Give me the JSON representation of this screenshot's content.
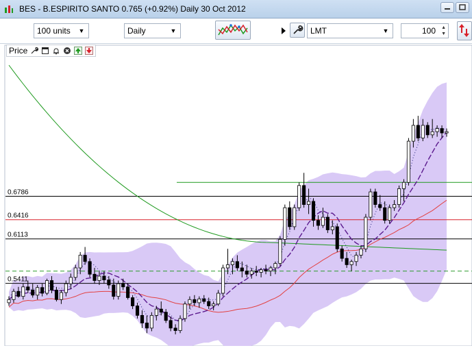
{
  "window": {
    "title": "BES - B.ESPIRITO SANTO   0.765 (+0.92%)   Daily  30 Oct 2012",
    "buttons": [
      "minimize",
      "maximize"
    ]
  },
  "toolbar": {
    "units_value": "100 units",
    "period_value": "Daily",
    "order_type_value": "LMT",
    "quantity_value": "100",
    "icons": [
      "indicator-chart-icon",
      "collapse-arrow-icon",
      "wrench-icon",
      "order-arrows-icon"
    ]
  },
  "legend": {
    "label": "Price",
    "icons": [
      "wrench-icon",
      "window-icon",
      "alarm-icon",
      "close-icon",
      "move-up-icon",
      "move-down-icon"
    ]
  },
  "colors": {
    "band_fill": "#d9c9f6",
    "up_candle": "#ffffff",
    "down_candle": "#000000",
    "ma_green": "#1f9a1f",
    "ma_red": "#e34040",
    "ma_purple": "#5b1a8e",
    "level_line": "#000000",
    "level_red": "#d8202a",
    "level_green": "#1f9a1f",
    "level_green_dashed": "#2a9a2a"
  },
  "chart_data": {
    "type": "candlestick",
    "title": "",
    "ylim": [
      0.445,
      0.91
    ],
    "levels": [
      {
        "value": 0.7005,
        "label": "",
        "style": "solid-green"
      },
      {
        "value": 0.6786,
        "label": "0.6786",
        "style": "solid-black"
      },
      {
        "value": 0.6416,
        "label": "0.6416",
        "style": "solid-red"
      },
      {
        "value": 0.6113,
        "label": "0.6113",
        "style": "solid-black"
      },
      {
        "value": 0.5605,
        "label": "",
        "style": "dashed-green"
      },
      {
        "value": 0.5411,
        "label": "0.5411",
        "style": "solid-black"
      }
    ],
    "candles": [
      [
        0.51,
        0.52,
        0.505,
        0.515
      ],
      [
        0.515,
        0.532,
        0.51,
        0.528
      ],
      [
        0.528,
        0.535,
        0.518,
        0.52
      ],
      [
        0.52,
        0.54,
        0.515,
        0.535
      ],
      [
        0.535,
        0.545,
        0.525,
        0.53
      ],
      [
        0.53,
        0.54,
        0.518,
        0.522
      ],
      [
        0.522,
        0.538,
        0.515,
        0.534
      ],
      [
        0.534,
        0.54,
        0.52,
        0.525
      ],
      [
        0.525,
        0.548,
        0.522,
        0.545
      ],
      [
        0.545,
        0.552,
        0.525,
        0.53
      ],
      [
        0.53,
        0.535,
        0.512,
        0.515
      ],
      [
        0.515,
        0.53,
        0.508,
        0.526
      ],
      [
        0.526,
        0.545,
        0.52,
        0.54
      ],
      [
        0.54,
        0.556,
        0.532,
        0.55
      ],
      [
        0.55,
        0.57,
        0.545,
        0.565
      ],
      [
        0.565,
        0.59,
        0.555,
        0.585
      ],
      [
        0.585,
        0.598,
        0.57,
        0.575
      ],
      [
        0.575,
        0.58,
        0.55,
        0.555
      ],
      [
        0.555,
        0.565,
        0.54,
        0.545
      ],
      [
        0.545,
        0.56,
        0.538,
        0.552
      ],
      [
        0.552,
        0.56,
        0.54,
        0.546
      ],
      [
        0.546,
        0.552,
        0.532,
        0.538
      ],
      [
        0.538,
        0.548,
        0.515,
        0.52
      ],
      [
        0.52,
        0.545,
        0.515,
        0.54
      ],
      [
        0.54,
        0.548,
        0.53,
        0.535
      ],
      [
        0.535,
        0.54,
        0.515,
        0.518
      ],
      [
        0.518,
        0.522,
        0.5,
        0.505
      ],
      [
        0.505,
        0.51,
        0.485,
        0.49
      ],
      [
        0.49,
        0.498,
        0.47,
        0.478
      ],
      [
        0.478,
        0.49,
        0.462,
        0.47
      ],
      [
        0.47,
        0.495,
        0.465,
        0.49
      ],
      [
        0.49,
        0.505,
        0.482,
        0.5
      ],
      [
        0.5,
        0.512,
        0.49,
        0.495
      ],
      [
        0.495,
        0.5,
        0.478,
        0.482
      ],
      [
        0.482,
        0.488,
        0.465,
        0.47
      ],
      [
        0.47,
        0.476,
        0.46,
        0.466
      ],
      [
        0.466,
        0.49,
        0.462,
        0.485
      ],
      [
        0.485,
        0.512,
        0.48,
        0.508
      ],
      [
        0.508,
        0.52,
        0.5,
        0.515
      ],
      [
        0.515,
        0.522,
        0.505,
        0.51
      ],
      [
        0.51,
        0.52,
        0.502,
        0.516
      ],
      [
        0.516,
        0.522,
        0.508,
        0.512
      ],
      [
        0.512,
        0.518,
        0.5,
        0.505
      ],
      [
        0.505,
        0.512,
        0.498,
        0.508
      ],
      [
        0.508,
        0.53,
        0.505,
        0.525
      ],
      [
        0.525,
        0.57,
        0.52,
        0.565
      ],
      [
        0.565,
        0.595,
        0.555,
        0.57
      ],
      [
        0.57,
        0.58,
        0.555,
        0.575
      ],
      [
        0.575,
        0.585,
        0.56,
        0.565
      ],
      [
        0.565,
        0.575,
        0.55,
        0.56
      ],
      [
        0.56,
        0.57,
        0.55,
        0.555
      ],
      [
        0.555,
        0.565,
        0.548,
        0.56
      ],
      [
        0.56,
        0.568,
        0.552,
        0.558
      ],
      [
        0.558,
        0.565,
        0.55,
        0.562
      ],
      [
        0.562,
        0.57,
        0.555,
        0.56
      ],
      [
        0.56,
        0.568,
        0.552,
        0.565
      ],
      [
        0.565,
        0.575,
        0.555,
        0.572
      ],
      [
        0.572,
        0.615,
        0.568,
        0.61
      ],
      [
        0.61,
        0.665,
        0.6,
        0.66
      ],
      [
        0.66,
        0.67,
        0.625,
        0.63
      ],
      [
        0.63,
        0.665,
        0.625,
        0.66
      ],
      [
        0.66,
        0.7,
        0.655,
        0.695
      ],
      [
        0.695,
        0.715,
        0.66,
        0.665
      ],
      [
        0.665,
        0.69,
        0.65,
        0.67
      ],
      [
        0.67,
        0.675,
        0.63,
        0.64
      ],
      [
        0.64,
        0.648,
        0.625,
        0.632
      ],
      [
        0.632,
        0.66,
        0.628,
        0.645
      ],
      [
        0.645,
        0.65,
        0.62,
        0.625
      ],
      [
        0.625,
        0.64,
        0.618,
        0.63
      ],
      [
        0.63,
        0.635,
        0.59,
        0.595
      ],
      [
        0.595,
        0.6,
        0.575,
        0.58
      ],
      [
        0.58,
        0.59,
        0.565,
        0.57
      ],
      [
        0.57,
        0.578,
        0.56,
        0.575
      ],
      [
        0.575,
        0.59,
        0.568,
        0.585
      ],
      [
        0.585,
        0.6,
        0.58,
        0.595
      ],
      [
        0.595,
        0.65,
        0.59,
        0.645
      ],
      [
        0.645,
        0.69,
        0.64,
        0.685
      ],
      [
        0.685,
        0.69,
        0.66,
        0.665
      ],
      [
        0.665,
        0.68,
        0.655,
        0.66
      ],
      [
        0.66,
        0.67,
        0.635,
        0.64
      ],
      [
        0.64,
        0.665,
        0.635,
        0.66
      ],
      [
        0.66,
        0.672,
        0.655,
        0.665
      ],
      [
        0.665,
        0.695,
        0.66,
        0.69
      ],
      [
        0.69,
        0.705,
        0.67,
        0.7
      ],
      [
        0.7,
        0.77,
        0.695,
        0.765
      ],
      [
        0.765,
        0.8,
        0.755,
        0.79
      ],
      [
        0.79,
        0.805,
        0.765,
        0.77
      ],
      [
        0.77,
        0.8,
        0.765,
        0.79
      ],
      [
        0.79,
        0.795,
        0.77,
        0.775
      ],
      [
        0.775,
        0.8,
        0.77,
        0.78
      ],
      [
        0.78,
        0.79,
        0.772,
        0.785
      ],
      [
        0.785,
        0.79,
        0.77,
        0.778
      ],
      [
        0.778,
        0.785,
        0.772,
        0.78
      ]
    ]
  }
}
